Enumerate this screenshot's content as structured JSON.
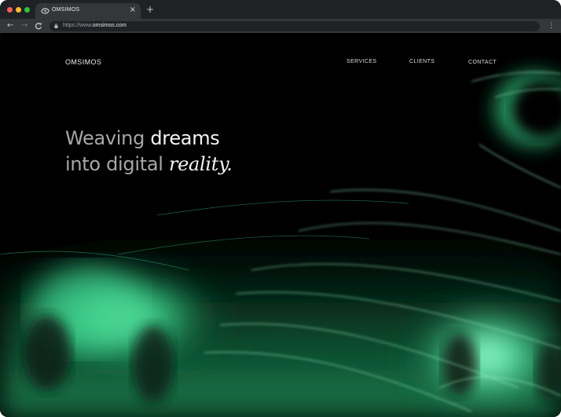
{
  "browser": {
    "tab_title": "OMSIMOS",
    "tab_close": "×",
    "new_tab": "+",
    "url_prefix": "https://www.",
    "url_domain": "omsimos.com",
    "back": "←",
    "forward": "→",
    "reload": "C",
    "menu": "⋮"
  },
  "site": {
    "brand": "OMSIMOS",
    "nav": [
      "SERVICES",
      "CLIENTS",
      "CONTACT"
    ],
    "headline": {
      "line1_dim": "Weaving",
      "line1_bright": "dreams",
      "line2_dim": "into digital",
      "line2_serif": "reality."
    }
  },
  "colors": {
    "accent_green": "#37e495",
    "background": "#000000"
  }
}
